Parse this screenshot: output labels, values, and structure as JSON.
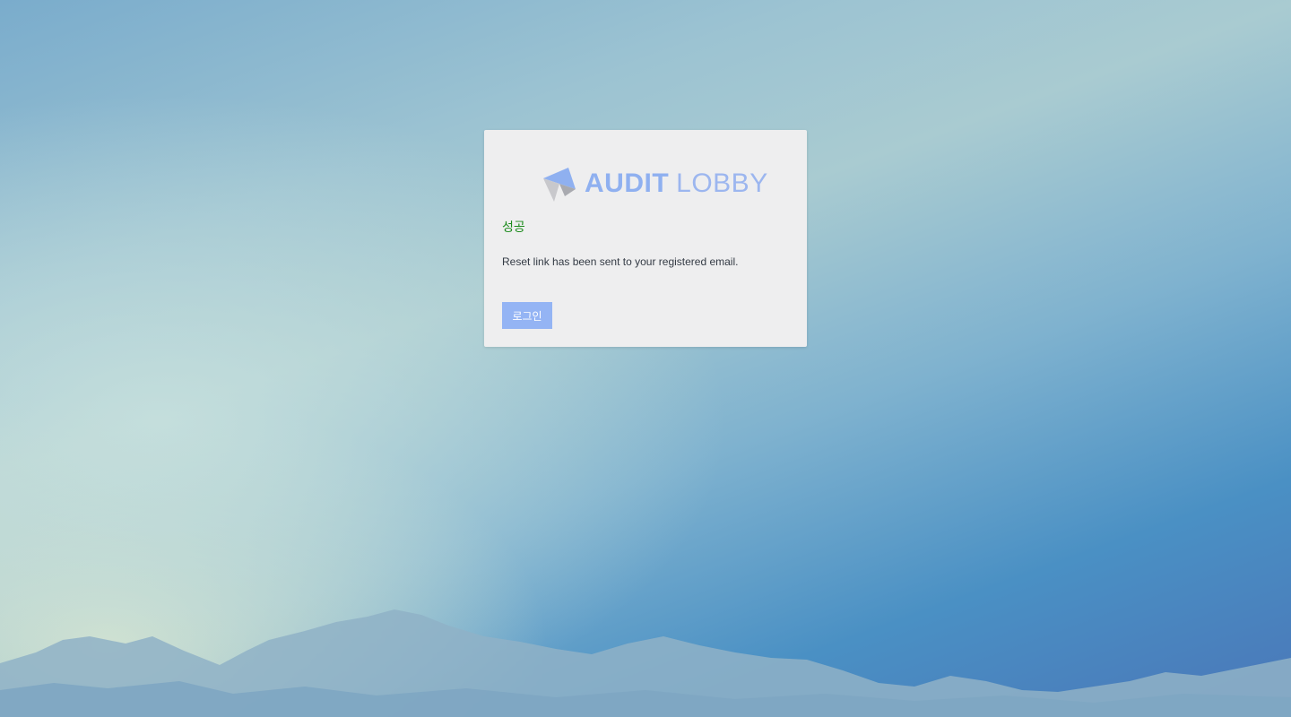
{
  "logo": {
    "brand_bold": "AUDIT",
    "brand_light": "LOBBY"
  },
  "dialog": {
    "status_title": "성공",
    "message": "Reset link has been sent to your registered email.",
    "login_button_label": "로그인"
  },
  "colors": {
    "brand_blue": "#8fb0f0",
    "success_green": "#1a8a1a",
    "button_bg": "#94b4f4",
    "card_bg": "#eeeeef"
  },
  "icons": {
    "logo_mark": "audit-lobby-logo-mark"
  }
}
